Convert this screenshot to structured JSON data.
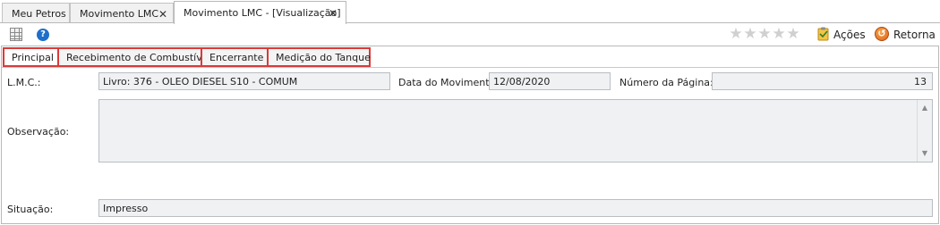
{
  "document_tabs": [
    {
      "label": "Meu Petros",
      "closable": false,
      "active": false
    },
    {
      "label": "Movimento LMC",
      "closable": true,
      "active": false
    },
    {
      "label": "Movimento LMC - [Visualização]",
      "closable": true,
      "active": true
    }
  ],
  "toolbar": {
    "grid_icon": "grid-icon",
    "help_icon": "help-icon",
    "rating": {
      "value": 0,
      "max": 5
    },
    "acoes_label": "Ações",
    "retorna_label": "Retorna"
  },
  "inner_tabs": [
    {
      "label": "Principal",
      "active": true
    },
    {
      "label": "Recebimento de Combustível",
      "active": false
    },
    {
      "label": "Encerrante",
      "active": false
    },
    {
      "label": "Medição do Tanque",
      "active": false
    }
  ],
  "form": {
    "lmc_label": "L.M.C.:",
    "lmc_value": "Livro: 376 - OLEO DIESEL S10 - COMUM",
    "data_label": "Data do Movimento:",
    "data_value": "12/08/2020",
    "pagina_label": "Número da Página:",
    "pagina_value": "13",
    "observacao_label": "Observação:",
    "observacao_value": "",
    "situacao_label": "Situação:",
    "situacao_value": "Impresso"
  },
  "colors": {
    "highlight": "#d93a3a",
    "field_bg": "#eff1f3",
    "help_blue": "#1e6fc9",
    "retorna_orange": "#e0651a"
  }
}
